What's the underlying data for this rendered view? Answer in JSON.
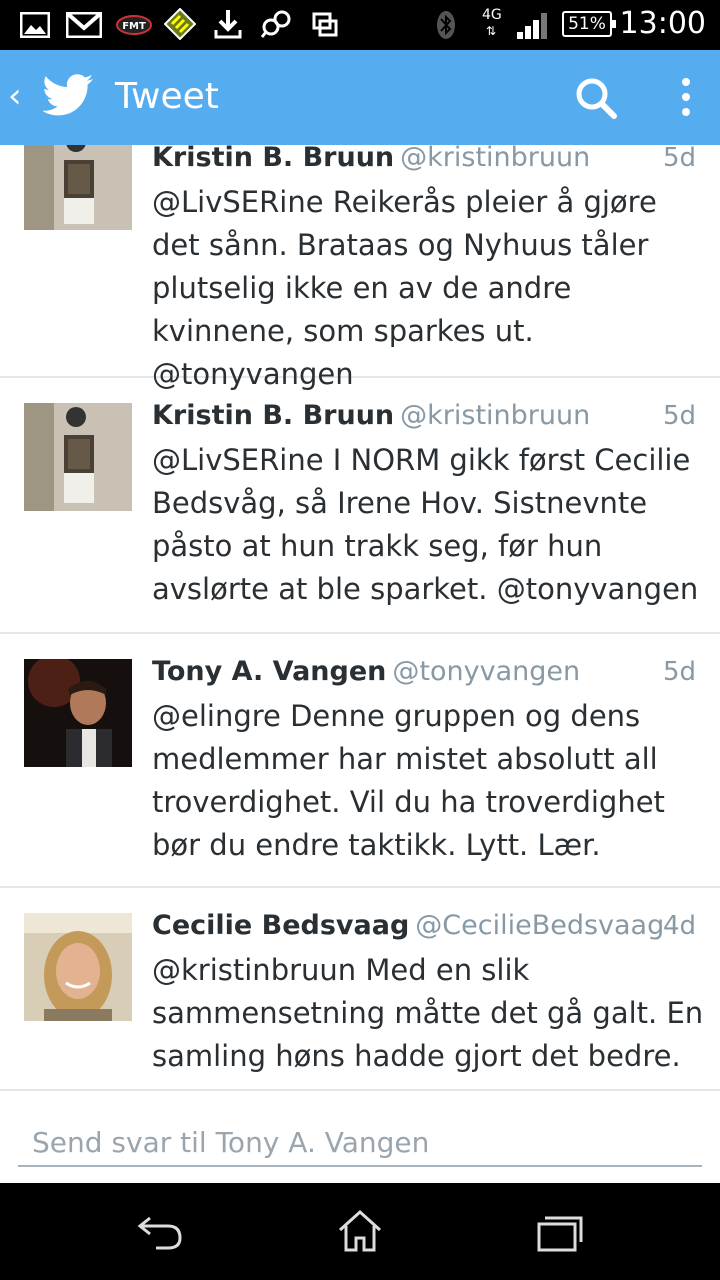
{
  "status_bar": {
    "time": "13:00",
    "battery": "51%",
    "network": "4G",
    "icons": [
      "image-icon",
      "gmail-icon",
      "fmt-icon",
      "app-icon",
      "download-icon",
      "share-icon",
      "screen-icon",
      "bluetooth-icon",
      "signal-icon"
    ]
  },
  "action_bar": {
    "title": "Tweet",
    "icons": [
      "back-chevron-icon",
      "twitter-bird-icon",
      "search-icon",
      "overflow-menu-icon"
    ]
  },
  "colors": {
    "accent": "#55acee",
    "text": "#292f33",
    "muted": "#8899a6",
    "divider": "#e1e8ed"
  },
  "tweets": [
    {
      "name": "Kristin B. Bruun",
      "handle": "@kristinbruun",
      "time": "5d",
      "text": "@LivSERine Reikerås pleier å gjøre det sånn. Brataas og Nyhuus tåler plutselig ikke en av de andre kvinnene, som sparkes ut. @tonyvangen"
    },
    {
      "name": "Kristin B. Bruun",
      "handle": "@kristinbruun",
      "time": "5d",
      "text": "@LivSERine I NORM gikk først Cecilie Bedsvåg, så Irene Hov. Sistnevnte påsto at hun trakk seg, før hun avslørte at ble sparket. @tonyvangen"
    },
    {
      "name": "Tony A. Vangen",
      "handle": "@tonyvangen",
      "time": "5d",
      "text": "@elingre Denne gruppen og dens medlemmer har mistet absolutt all troverdighet. Vil du ha troverdighet bør du endre taktikk. Lytt. Lær."
    },
    {
      "name": "Cecilie Bedsvaag",
      "handle": "@CecilieBedsvaag",
      "time": "4d",
      "text": "@kristinbruun Med en slik sammensetning måtte det gå galt. En samling høns hadde gjort det bedre."
    }
  ],
  "reply": {
    "placeholder": "Send svar til Tony A. Vangen"
  },
  "nav_bar": {
    "icons": [
      "back-icon",
      "home-icon",
      "recent-apps-icon"
    ]
  }
}
